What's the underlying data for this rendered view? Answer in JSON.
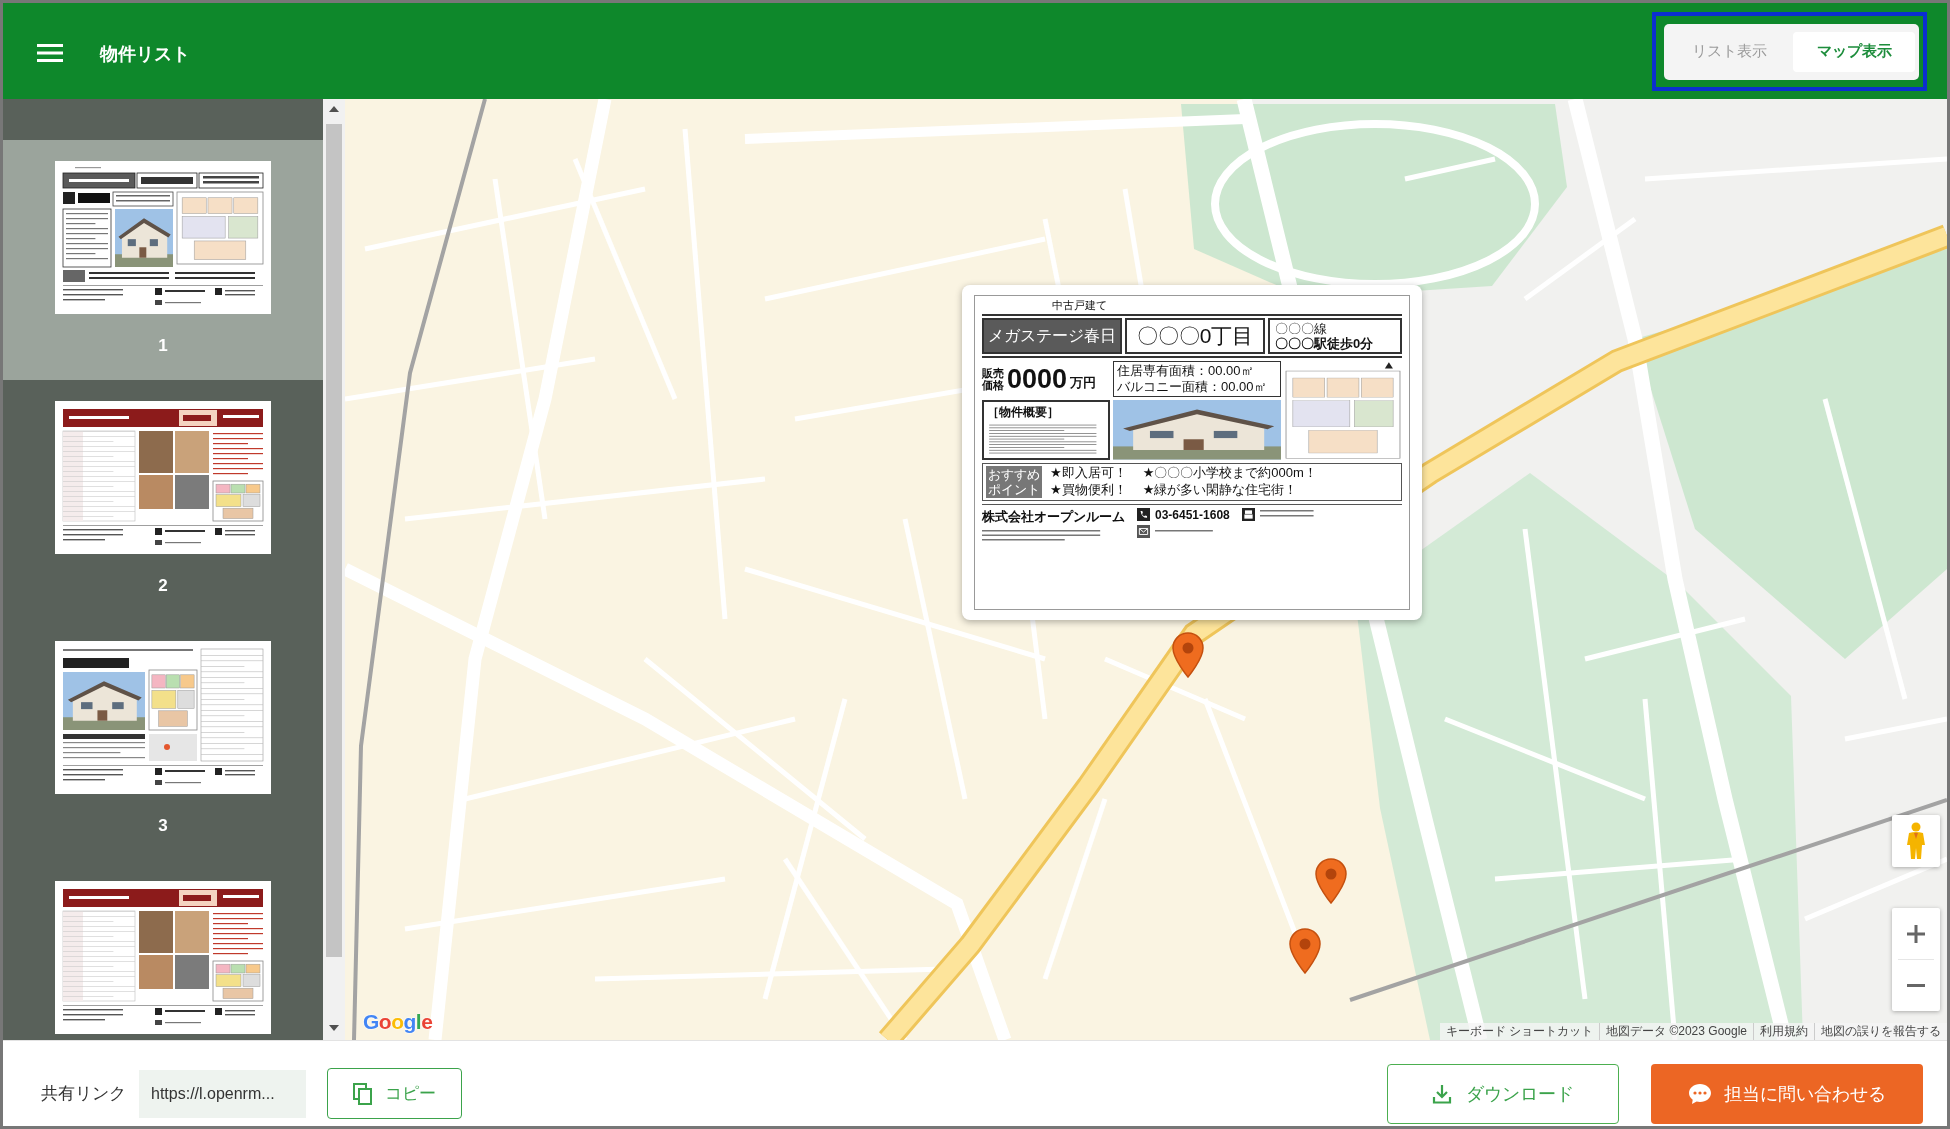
{
  "header": {
    "title": "物件リスト",
    "view_tabs": [
      {
        "label": "リスト表示",
        "selected": false
      },
      {
        "label": "マップ表示",
        "selected": true
      }
    ]
  },
  "sidebar": {
    "flyers": [
      {
        "kind": "boxed",
        "label": "1",
        "selected": true
      },
      {
        "kind": "banner",
        "label": "2",
        "selected": false
      },
      {
        "kind": "photo",
        "label": "3",
        "selected": false
      },
      {
        "kind": "banner",
        "selected": false
      }
    ]
  },
  "map": {
    "popup": {
      "category": "中古戸建て",
      "title": "メガステージ春日",
      "address": "〇〇〇0丁目",
      "line": "〇〇〇線",
      "station": "〇〇〇駅徒歩0分",
      "price_label": "販売価格",
      "price": "0000",
      "price_unit": "万円",
      "areas": [
        "住居専有面積：00.00㎡",
        "バルコニー面積：00.00㎡"
      ],
      "overview_heading": "［物件概要］",
      "points_label": "おすすめポイント",
      "points": [
        "★即入居可！",
        "★〇〇〇小学校まで約000m！",
        "★買物便利！",
        "★緑が多い閑静な住宅街！"
      ],
      "company": "株式会社オープンルーム",
      "phone": "03-6451-1608"
    },
    "logo": "Google",
    "attribution": [
      "キーボード ショートカット",
      "地図データ ©2023 Google",
      "利用規約",
      "地図の誤りを報告する"
    ]
  },
  "footer": {
    "share_label": "共有リンク",
    "share_url": "https://l.openrm...",
    "copy_button": "コピー",
    "download_button": "ダウンロード",
    "contact_button": "担当に問い合わせる"
  }
}
